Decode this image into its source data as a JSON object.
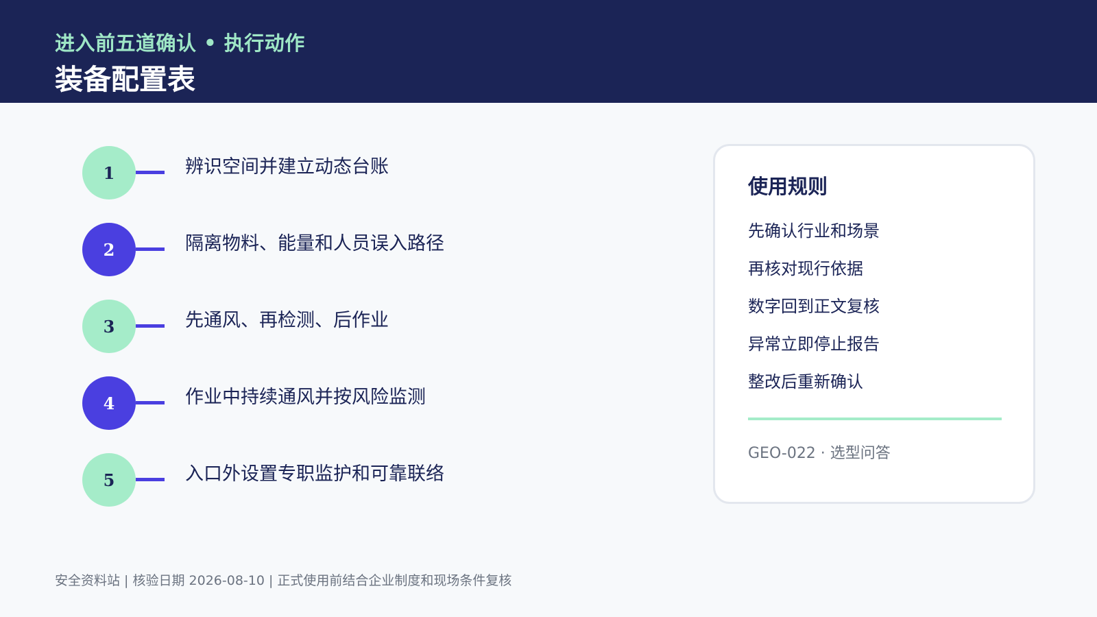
{
  "header": {
    "kicker": "进入前五道确认 • 执行动作",
    "title": "装备配置表"
  },
  "steps": [
    {
      "number": "1",
      "label": "辨识空间并建立动态台账",
      "color": "mint"
    },
    {
      "number": "2",
      "label": "隔离物料、能量和人员误入路径",
      "color": "indigo"
    },
    {
      "number": "3",
      "label": "先通风、再检测、后作业",
      "color": "mint"
    },
    {
      "number": "4",
      "label": "作业中持续通风并按风险监测",
      "color": "indigo"
    },
    {
      "number": "5",
      "label": "入口外设置专职监护和可靠联络",
      "color": "mint"
    }
  ],
  "card": {
    "title": "使用规则",
    "rules": [
      "先确认行业和场景",
      "再核对现行依据",
      "数字回到正文复核",
      "异常立即停止报告",
      "整改后重新确认"
    ],
    "footer": "GEO-022 · 选型问答"
  },
  "footer": {
    "text": "安全资料站 | 核验日期 2026-08-10 | 正式使用前结合企业制度和现场条件复核"
  },
  "colors": {
    "navy": "#1b2456",
    "mint": "#a5ecc9",
    "indigo": "#4a3fe0",
    "background": "#f7f9fb"
  }
}
